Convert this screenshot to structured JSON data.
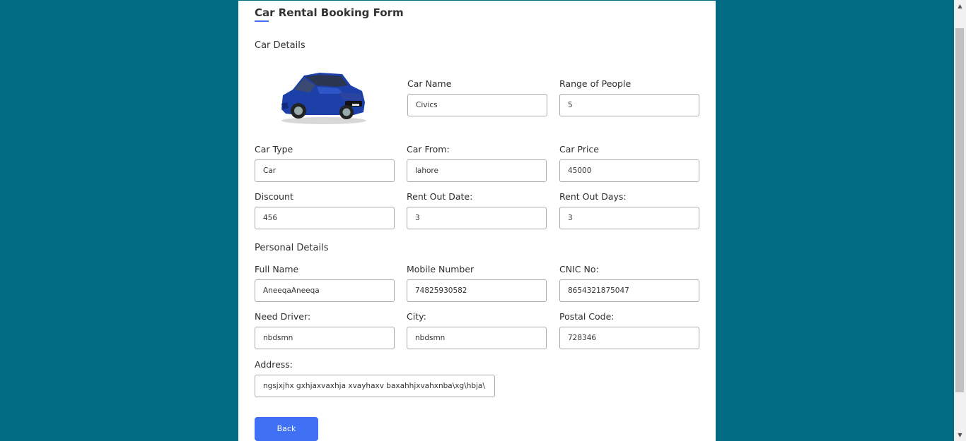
{
  "form": {
    "title": "Car Rental Booking Form",
    "car_details_heading": "Car Details",
    "personal_details_heading": "Personal Details",
    "back_label": "Back"
  },
  "car": {
    "image_icon": "car-image-icon",
    "name": {
      "label": "Car Name",
      "value": "Civics"
    },
    "range_of_people": {
      "label": "Range of People",
      "value": "5"
    },
    "type": {
      "label": "Car Type",
      "value": "Car"
    },
    "from": {
      "label": "Car From:",
      "value": "lahore"
    },
    "price": {
      "label": "Car Price",
      "value": "45000"
    },
    "discount": {
      "label": "Discount",
      "value": "456"
    },
    "rent_out_date": {
      "label": "Rent Out Date:",
      "value": "3"
    },
    "rent_out_days": {
      "label": "Rent Out Days:",
      "value": "3"
    }
  },
  "personal": {
    "full_name": {
      "label": "Full Name",
      "value": "AneeqaAneeqa"
    },
    "mobile_number": {
      "label": "Mobile Number",
      "value": "74825930582"
    },
    "cnic_no": {
      "label": "CNIC No:",
      "value": "8654321875047"
    },
    "need_driver": {
      "label": "Need Driver:",
      "value": "nbdsmn"
    },
    "city": {
      "label": "City:",
      "value": "nbdsmn"
    },
    "postal_code": {
      "label": "Postal Code:",
      "value": "728346"
    },
    "address": {
      "label": "Address:",
      "value": "ngsjxjhx gxhjaxvaxhja xvayhaxv baxahhjxvahxnba\\xg\\hbja\\"
    }
  },
  "colors": {
    "background": "#006b82",
    "accent": "#4070f4",
    "car_body": "#1c3fa8"
  }
}
